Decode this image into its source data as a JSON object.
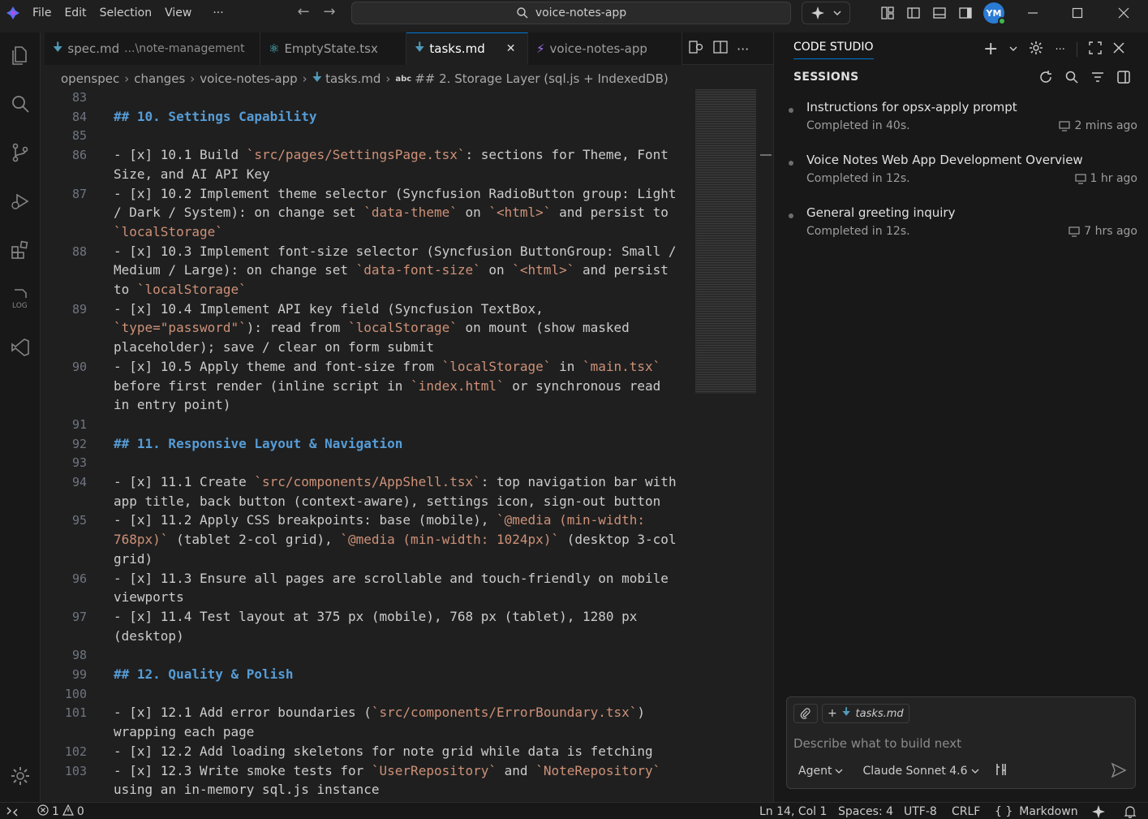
{
  "titlebar": {
    "menu": [
      "File",
      "Edit",
      "Selection",
      "View",
      "···"
    ],
    "command_center": "voice-notes-app",
    "avatar_initials": "YM"
  },
  "tabs": [
    {
      "label": "spec.md",
      "path": "...\\note-management"
    },
    {
      "label": "EmptyState.tsx"
    },
    {
      "label": "tasks.md",
      "close": "✕"
    },
    {
      "label": "voice-notes-app"
    }
  ],
  "breadcrumb": {
    "parts": [
      "openspec",
      "changes",
      "voice-notes-app",
      "tasks.md"
    ],
    "symbol_badge": "abc",
    "symbol": "## 2. Storage Layer (sql.js + IndexedDB)"
  },
  "editor": {
    "lines": [
      {
        "n": "83",
        "text": ""
      },
      {
        "n": "84",
        "text": "## 10. Settings Capability"
      },
      {
        "n": "85",
        "text": ""
      },
      {
        "n": "86",
        "text": "- [x] 10.1 Build `src/pages/SettingsPage.tsx`: sections for Theme, Font Size, and AI API Key"
      },
      {
        "n": "87",
        "text": "- [x] 10.2 Implement theme selector (Syncfusion RadioButton group: Light / Dark / System): on change set `data-theme` on `<html>` and persist to `localStorage`"
      },
      {
        "n": "88",
        "text": "- [x] 10.3 Implement font-size selector (Syncfusion ButtonGroup: Small / Medium / Large): on change set `data-font-size` on `<html>` and persist to `localStorage`"
      },
      {
        "n": "89",
        "text": "- [x] 10.4 Implement API key field (Syncfusion TextBox, `type=\"password\"`): read from `localStorage` on mount (show masked placeholder); save / clear on form submit"
      },
      {
        "n": "90",
        "text": "- [x] 10.5 Apply theme and font-size from `localStorage` in `main.tsx` before first render (inline script in `index.html` or synchronous read in entry point)"
      },
      {
        "n": "91",
        "text": ""
      },
      {
        "n": "92",
        "text": "## 11. Responsive Layout & Navigation"
      },
      {
        "n": "93",
        "text": ""
      },
      {
        "n": "94",
        "text": "- [x] 11.1 Create `src/components/AppShell.tsx`: top navigation bar with app title, back button (context-aware), settings icon, sign-out button"
      },
      {
        "n": "95",
        "text": "- [x] 11.2 Apply CSS breakpoints: base (mobile), `@media (min-width: 768px)` (tablet 2-col grid), `@media (min-width: 1024px)` (desktop 3-col grid)"
      },
      {
        "n": "96",
        "text": "- [x] 11.3 Ensure all pages are scrollable and touch-friendly on mobile viewports"
      },
      {
        "n": "97",
        "text": "- [x] 11.4 Test layout at 375 px (mobile), 768 px (tablet), 1280 px (desktop)"
      },
      {
        "n": "98",
        "text": ""
      },
      {
        "n": "99",
        "text": "## 12. Quality & Polish"
      },
      {
        "n": "100",
        "text": ""
      },
      {
        "n": "101",
        "text": "- [x] 12.1 Add error boundaries (`src/components/ErrorBoundary.tsx`) wrapping each page"
      },
      {
        "n": "102",
        "text": "- [x] 12.2 Add loading skeletons for note grid while data is fetching"
      },
      {
        "n": "103",
        "text": "- [x] 12.3 Write smoke tests for `UserRepository` and `NoteRepository` using an in-memory sql.js instance"
      }
    ]
  },
  "studio": {
    "header": "CODE STUDIO",
    "sessions_title": "SESSIONS",
    "sessions": [
      {
        "title": "Instructions for opsx-apply prompt",
        "status": "Completed in 40s.",
        "time": "2 mins ago"
      },
      {
        "title": "Voice Notes Web App Development Overview",
        "status": "Completed in 12s.",
        "time": "1 hr ago"
      },
      {
        "title": "General greeting inquiry",
        "status": "Completed in 12s.",
        "time": "7 hrs ago"
      }
    ],
    "chat": {
      "context_file": "tasks.md",
      "placeholder": "Describe what to build next",
      "mode": "Agent",
      "model": "Claude Sonnet 4.6"
    }
  },
  "statusbar": {
    "errors": "1",
    "warnings": "0",
    "position": "Ln 14, Col 1",
    "spaces": "Spaces: 4",
    "encoding": "UTF-8",
    "eol": "CRLF",
    "language_icon": "{ }",
    "language": "Markdown"
  },
  "colors": {
    "accent": "#0078d4",
    "heading": "#569cd6",
    "inline_code": "#ce9178",
    "online": "#3fb950"
  }
}
